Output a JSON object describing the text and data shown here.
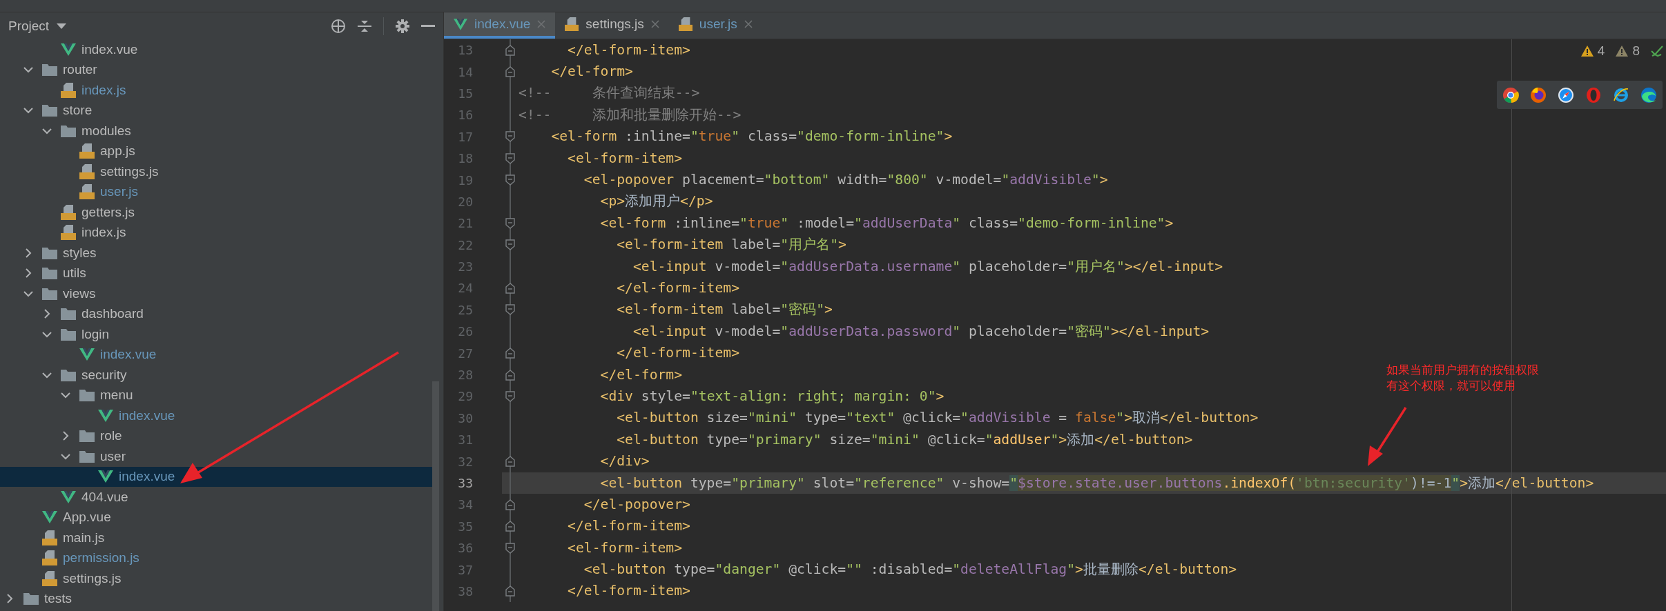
{
  "project_panel": {
    "title": "Project"
  },
  "tree": [
    {
      "children": [
        {
          "children": [
            {
              "name": "index.vue",
              "kind": "vue",
              "modified": false,
              "selected": false
            }
          ]
        },
        {
          "name": "router",
          "kind": "folder",
          "expanded": true,
          "selected": false,
          "children": [
            {
              "name": "index.js",
              "kind": "js",
              "modified": true,
              "selected": false
            }
          ]
        },
        {
          "name": "store",
          "kind": "folder",
          "expanded": true,
          "selected": false,
          "children": [
            {
              "name": "modules",
              "kind": "folder",
              "expanded": true,
              "selected": false,
              "children": [
                {
                  "name": "app.js",
                  "kind": "js",
                  "modified": false,
                  "selected": false
                },
                {
                  "name": "settings.js",
                  "kind": "js",
                  "modified": false,
                  "selected": false
                },
                {
                  "name": "user.js",
                  "kind": "js",
                  "modified": true,
                  "selected": false
                }
              ]
            },
            {
              "name": "getters.js",
              "kind": "js",
              "modified": false,
              "selected": false
            },
            {
              "name": "index.js",
              "kind": "js",
              "modified": false,
              "selected": false
            }
          ]
        },
        {
          "name": "styles",
          "kind": "folder",
          "expanded": false,
          "selected": false
        },
        {
          "name": "utils",
          "kind": "folder",
          "expanded": false,
          "selected": false
        },
        {
          "name": "views",
          "kind": "folder",
          "expanded": true,
          "selected": false,
          "children": [
            {
              "name": "dashboard",
              "kind": "folder",
              "expanded": false,
              "selected": false
            },
            {
              "name": "login",
              "kind": "folder",
              "expanded": true,
              "selected": false,
              "children": [
                {
                  "name": "index.vue",
                  "kind": "vue",
                  "modified": true,
                  "selected": false
                }
              ]
            },
            {
              "name": "security",
              "kind": "folder",
              "expanded": true,
              "selected": false,
              "children": [
                {
                  "name": "menu",
                  "kind": "folder",
                  "expanded": true,
                  "selected": false,
                  "children": [
                    {
                      "name": "index.vue",
                      "kind": "vue",
                      "modified": true,
                      "selected": false
                    }
                  ]
                },
                {
                  "name": "role",
                  "kind": "folder",
                  "expanded": false,
                  "selected": false
                },
                {
                  "name": "user",
                  "kind": "folder",
                  "expanded": true,
                  "selected": false,
                  "children": [
                    {
                      "name": "index.vue",
                      "kind": "vue",
                      "modified": true,
                      "selected": true
                    }
                  ]
                }
              ]
            },
            {
              "name": "404.vue",
              "kind": "vue",
              "modified": false,
              "selected": false
            }
          ]
        },
        {
          "name": "App.vue",
          "kind": "vue",
          "modified": false,
          "selected": false
        },
        {
          "name": "main.js",
          "kind": "js",
          "modified": false,
          "selected": false
        },
        {
          "name": "permission.js",
          "kind": "js",
          "modified": true,
          "selected": false
        },
        {
          "name": "settings.js",
          "kind": "js",
          "modified": false,
          "selected": false
        }
      ]
    },
    {
      "name": "tests",
      "kind": "folder",
      "expanded": false,
      "selected": false
    }
  ],
  "tabs": [
    {
      "label": "index.vue",
      "kind": "vue",
      "modified": true,
      "selected": true
    },
    {
      "label": "settings.js",
      "kind": "js",
      "modified": false,
      "selected": false
    },
    {
      "label": "user.js",
      "kind": "js",
      "modified": true,
      "selected": false
    }
  ],
  "inspections": {
    "warnings": "4",
    "weak_warnings": "8"
  },
  "code_lines": [
    {
      "number": "13",
      "kind": "fold-end",
      "current": false,
      "tokens": [
        {
          "kind": "tag",
          "text": "      </el-form-item>"
        }
      ]
    },
    {
      "number": "14",
      "kind": "fold-end",
      "current": false,
      "tokens": [
        {
          "kind": "tag",
          "text": "    </el-form>"
        }
      ]
    },
    {
      "number": "15",
      "kind": "plain",
      "current": false,
      "tokens": [
        {
          "kind": "comment",
          "text": "<!--     条件查询结束-->"
        }
      ]
    },
    {
      "number": "16",
      "kind": "plain",
      "current": false,
      "tokens": [
        {
          "kind": "comment",
          "text": "<!--     添加和批量删除开始-->"
        }
      ]
    },
    {
      "number": "17",
      "kind": "fold-start",
      "current": false,
      "tokens": [
        {
          "kind": "tag",
          "text": "    <el-form"
        },
        {
          "kind": "attr",
          "text": " :inline="
        },
        {
          "kind": "str",
          "text": "\""
        },
        {
          "kind": "kw",
          "text": "true"
        },
        {
          "kind": "str",
          "text": "\""
        },
        {
          "kind": "attr",
          "text": " class="
        },
        {
          "kind": "str",
          "text": "\"demo-form-inline\""
        },
        {
          "kind": "tag",
          "text": ">"
        }
      ]
    },
    {
      "number": "18",
      "kind": "fold-start",
      "current": false,
      "tokens": [
        {
          "kind": "tag",
          "text": "      <el-form-item>"
        }
      ]
    },
    {
      "number": "19",
      "kind": "fold-start",
      "current": false,
      "tokens": [
        {
          "kind": "tag",
          "text": "        <el-popover"
        },
        {
          "kind": "attr",
          "text": " placement="
        },
        {
          "kind": "str",
          "text": "\"bottom\""
        },
        {
          "kind": "attr",
          "text": " width="
        },
        {
          "kind": "str",
          "text": "\"800\""
        },
        {
          "kind": "attr",
          "text": " v-model="
        },
        {
          "kind": "str",
          "text": "\""
        },
        {
          "kind": "bind",
          "text": "addVisible"
        },
        {
          "kind": "str",
          "text": "\""
        },
        {
          "kind": "tag",
          "text": ">"
        }
      ]
    },
    {
      "number": "20",
      "kind": "plain",
      "current": false,
      "tokens": [
        {
          "kind": "tag",
          "text": "          <p>"
        },
        {
          "kind": "text",
          "text": "添加用户"
        },
        {
          "kind": "tag",
          "text": "</p>"
        }
      ]
    },
    {
      "number": "21",
      "kind": "fold-start",
      "current": false,
      "tokens": [
        {
          "kind": "tag",
          "text": "          <el-form"
        },
        {
          "kind": "attr",
          "text": " :inline="
        },
        {
          "kind": "str",
          "text": "\""
        },
        {
          "kind": "kw",
          "text": "true"
        },
        {
          "kind": "str",
          "text": "\""
        },
        {
          "kind": "attr",
          "text": " :model="
        },
        {
          "kind": "str",
          "text": "\""
        },
        {
          "kind": "bind",
          "text": "addUserData"
        },
        {
          "kind": "str",
          "text": "\""
        },
        {
          "kind": "attr",
          "text": " class="
        },
        {
          "kind": "str",
          "text": "\"demo-form-inline\""
        },
        {
          "kind": "tag",
          "text": ">"
        }
      ]
    },
    {
      "number": "22",
      "kind": "fold-start",
      "current": false,
      "tokens": [
        {
          "kind": "tag",
          "text": "            <el-form-item"
        },
        {
          "kind": "attr",
          "text": " label="
        },
        {
          "kind": "str",
          "text": "\"用户名\""
        },
        {
          "kind": "tag",
          "text": ">"
        }
      ]
    },
    {
      "number": "23",
      "kind": "plain",
      "current": false,
      "tokens": [
        {
          "kind": "tag",
          "text": "              <el-input"
        },
        {
          "kind": "attr",
          "text": " v-model="
        },
        {
          "kind": "str",
          "text": "\""
        },
        {
          "kind": "bind",
          "text": "addUserData.username"
        },
        {
          "kind": "str",
          "text": "\""
        },
        {
          "kind": "attr",
          "text": " placeholder="
        },
        {
          "kind": "str",
          "text": "\"用户名\""
        },
        {
          "kind": "tag",
          "text": "></el-input>"
        }
      ]
    },
    {
      "number": "24",
      "kind": "fold-end",
      "current": false,
      "tokens": [
        {
          "kind": "tag",
          "text": "            </el-form-item>"
        }
      ]
    },
    {
      "number": "25",
      "kind": "fold-start",
      "current": false,
      "tokens": [
        {
          "kind": "tag",
          "text": "            <el-form-item"
        },
        {
          "kind": "attr",
          "text": " label="
        },
        {
          "kind": "str",
          "text": "\"密码\""
        },
        {
          "kind": "tag",
          "text": ">"
        }
      ]
    },
    {
      "number": "26",
      "kind": "plain",
      "current": false,
      "tokens": [
        {
          "kind": "tag",
          "text": "              <el-input"
        },
        {
          "kind": "attr",
          "text": " v-model="
        },
        {
          "kind": "str",
          "text": "\""
        },
        {
          "kind": "bind",
          "text": "addUserData.password"
        },
        {
          "kind": "str",
          "text": "\""
        },
        {
          "kind": "attr",
          "text": " placeholder="
        },
        {
          "kind": "str",
          "text": "\"密码\""
        },
        {
          "kind": "tag",
          "text": "></el-input>"
        }
      ]
    },
    {
      "number": "27",
      "kind": "fold-end",
      "current": false,
      "tokens": [
        {
          "kind": "tag",
          "text": "            </el-form-item>"
        }
      ]
    },
    {
      "number": "28",
      "kind": "fold-end",
      "current": false,
      "tokens": [
        {
          "kind": "tag",
          "text": "          </el-form>"
        }
      ]
    },
    {
      "number": "29",
      "kind": "fold-start",
      "current": false,
      "tokens": [
        {
          "kind": "tag",
          "text": "          <div"
        },
        {
          "kind": "attr",
          "text": " style="
        },
        {
          "kind": "str",
          "text": "\"text-align: right; margin: 0\""
        },
        {
          "kind": "tag",
          "text": ">"
        }
      ]
    },
    {
      "number": "30",
      "kind": "plain",
      "current": false,
      "tokens": [
        {
          "kind": "tag",
          "text": "            <el-button"
        },
        {
          "kind": "attr",
          "text": " size="
        },
        {
          "kind": "str",
          "text": "\"mini\""
        },
        {
          "kind": "attr",
          "text": " type="
        },
        {
          "kind": "str",
          "text": "\"text\""
        },
        {
          "kind": "attr",
          "text": " @click="
        },
        {
          "kind": "str",
          "text": "\""
        },
        {
          "kind": "bind",
          "text": "addVisible"
        },
        {
          "kind": "attr",
          "text": " = "
        },
        {
          "kind": "kw",
          "text": "false"
        },
        {
          "kind": "str",
          "text": "\""
        },
        {
          "kind": "tag",
          "text": ">"
        },
        {
          "kind": "text",
          "text": "取消"
        },
        {
          "kind": "tag",
          "text": "</el-button>"
        }
      ]
    },
    {
      "number": "31",
      "kind": "plain",
      "current": false,
      "tokens": [
        {
          "kind": "tag",
          "text": "            <el-button"
        },
        {
          "kind": "attr",
          "text": " type="
        },
        {
          "kind": "str",
          "text": "\"primary\""
        },
        {
          "kind": "attr",
          "text": " size="
        },
        {
          "kind": "str",
          "text": "\"mini\""
        },
        {
          "kind": "attr",
          "text": " @click="
        },
        {
          "kind": "str",
          "text": "\""
        },
        {
          "kind": "fn",
          "text": "addUser"
        },
        {
          "kind": "str",
          "text": "\""
        },
        {
          "kind": "tag",
          "text": ">"
        },
        {
          "kind": "text",
          "text": "添加"
        },
        {
          "kind": "tag",
          "text": "</el-button>"
        }
      ]
    },
    {
      "number": "32",
      "kind": "fold-end",
      "current": false,
      "tokens": [
        {
          "kind": "tag",
          "text": "          </div>"
        }
      ]
    },
    {
      "number": "33",
      "kind": "plain",
      "current": true,
      "tokens": [
        {
          "kind": "tag",
          "text": "          <el-button"
        },
        {
          "kind": "attr",
          "text": " type="
        },
        {
          "kind": "str",
          "text": "\"primary\""
        },
        {
          "kind": "attr",
          "text": " slot="
        },
        {
          "kind": "str",
          "text": "\"reference\""
        },
        {
          "kind": "attr",
          "text": " v-show="
        },
        {
          "kind": "match-quote",
          "text": "\""
        },
        {
          "kind": "sel-var",
          "text": "$store.state.user.buttons"
        },
        {
          "kind": "sel-fn",
          "text": ".indexOf("
        },
        {
          "kind": "sel-str",
          "text": "'btn:security'"
        },
        {
          "kind": "sel-op",
          "text": ")!=-1"
        },
        {
          "kind": "match-quote",
          "text": "\""
        },
        {
          "kind": "tag",
          "text": ">"
        },
        {
          "kind": "text",
          "text": "添加"
        },
        {
          "kind": "tag",
          "text": "</el-button>"
        }
      ]
    },
    {
      "number": "34",
      "kind": "fold-end",
      "current": false,
      "tokens": [
        {
          "kind": "tag",
          "text": "        </el-popover>"
        }
      ]
    },
    {
      "number": "35",
      "kind": "fold-end",
      "current": false,
      "tokens": [
        {
          "kind": "tag",
          "text": "      </el-form-item>"
        }
      ]
    },
    {
      "number": "36",
      "kind": "fold-start",
      "current": false,
      "tokens": [
        {
          "kind": "tag",
          "text": "      <el-form-item>"
        }
      ]
    },
    {
      "number": "37",
      "kind": "plain",
      "current": false,
      "tokens": [
        {
          "kind": "tag",
          "text": "        <el-button"
        },
        {
          "kind": "attr",
          "text": " type="
        },
        {
          "kind": "str",
          "text": "\"danger\""
        },
        {
          "kind": "attr",
          "text": " @click="
        },
        {
          "kind": "str",
          "text": "\"\""
        },
        {
          "kind": "attr",
          "text": " :disabled="
        },
        {
          "kind": "str",
          "text": "\""
        },
        {
          "kind": "bind",
          "text": "deleteAllFlag"
        },
        {
          "kind": "str",
          "text": "\""
        },
        {
          "kind": "tag",
          "text": ">"
        },
        {
          "kind": "text",
          "text": "批量删除"
        },
        {
          "kind": "tag",
          "text": "</el-button>"
        }
      ]
    },
    {
      "number": "38",
      "kind": "fold-end",
      "current": false,
      "tokens": [
        {
          "kind": "tag",
          "text": "      </el-form-item>"
        }
      ]
    }
  ],
  "annotation": {
    "lines": [
      "如果当前用户拥有的按钮权限",
      "有这个权限，就可以使用"
    ]
  }
}
